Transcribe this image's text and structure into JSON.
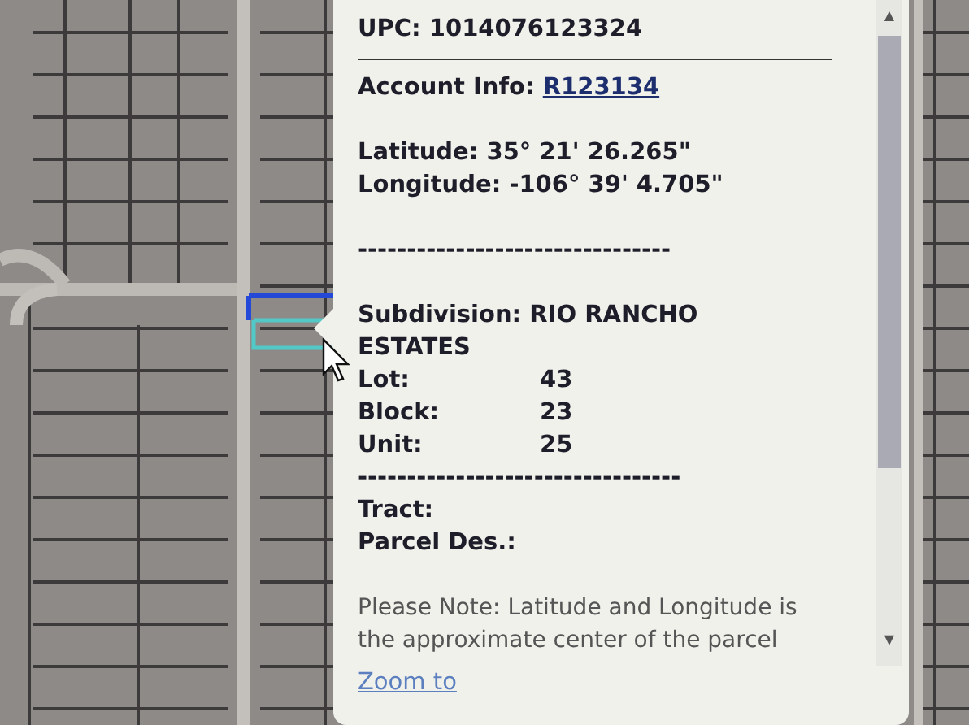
{
  "popup": {
    "title": "UPC: 1014076123324",
    "account": {
      "label": "Account Info:",
      "link": "R123134"
    },
    "coordinates": [
      "Latitude: 35° 21' 26.265\"",
      "Longitude: -106° 39' 4.705\""
    ],
    "separator_1": "--------------------------------",
    "subdivision": "Subdivision: RIO RANCHO ESTATES",
    "fields": [
      {
        "label": "Lot:",
        "value": "43"
      },
      {
        "label": "Block:",
        "value": "23"
      },
      {
        "label": "Unit:",
        "value": "25"
      }
    ],
    "separator_2": "---------------------------------",
    "extra_fields": [
      "Tract:",
      "Parcel Des.:"
    ],
    "note": "Please Note: Latitude and Longitude is the approximate center of the parcel",
    "scroll_up": "▲",
    "scroll_down": "▼",
    "zoom_link": "Zoom to"
  }
}
